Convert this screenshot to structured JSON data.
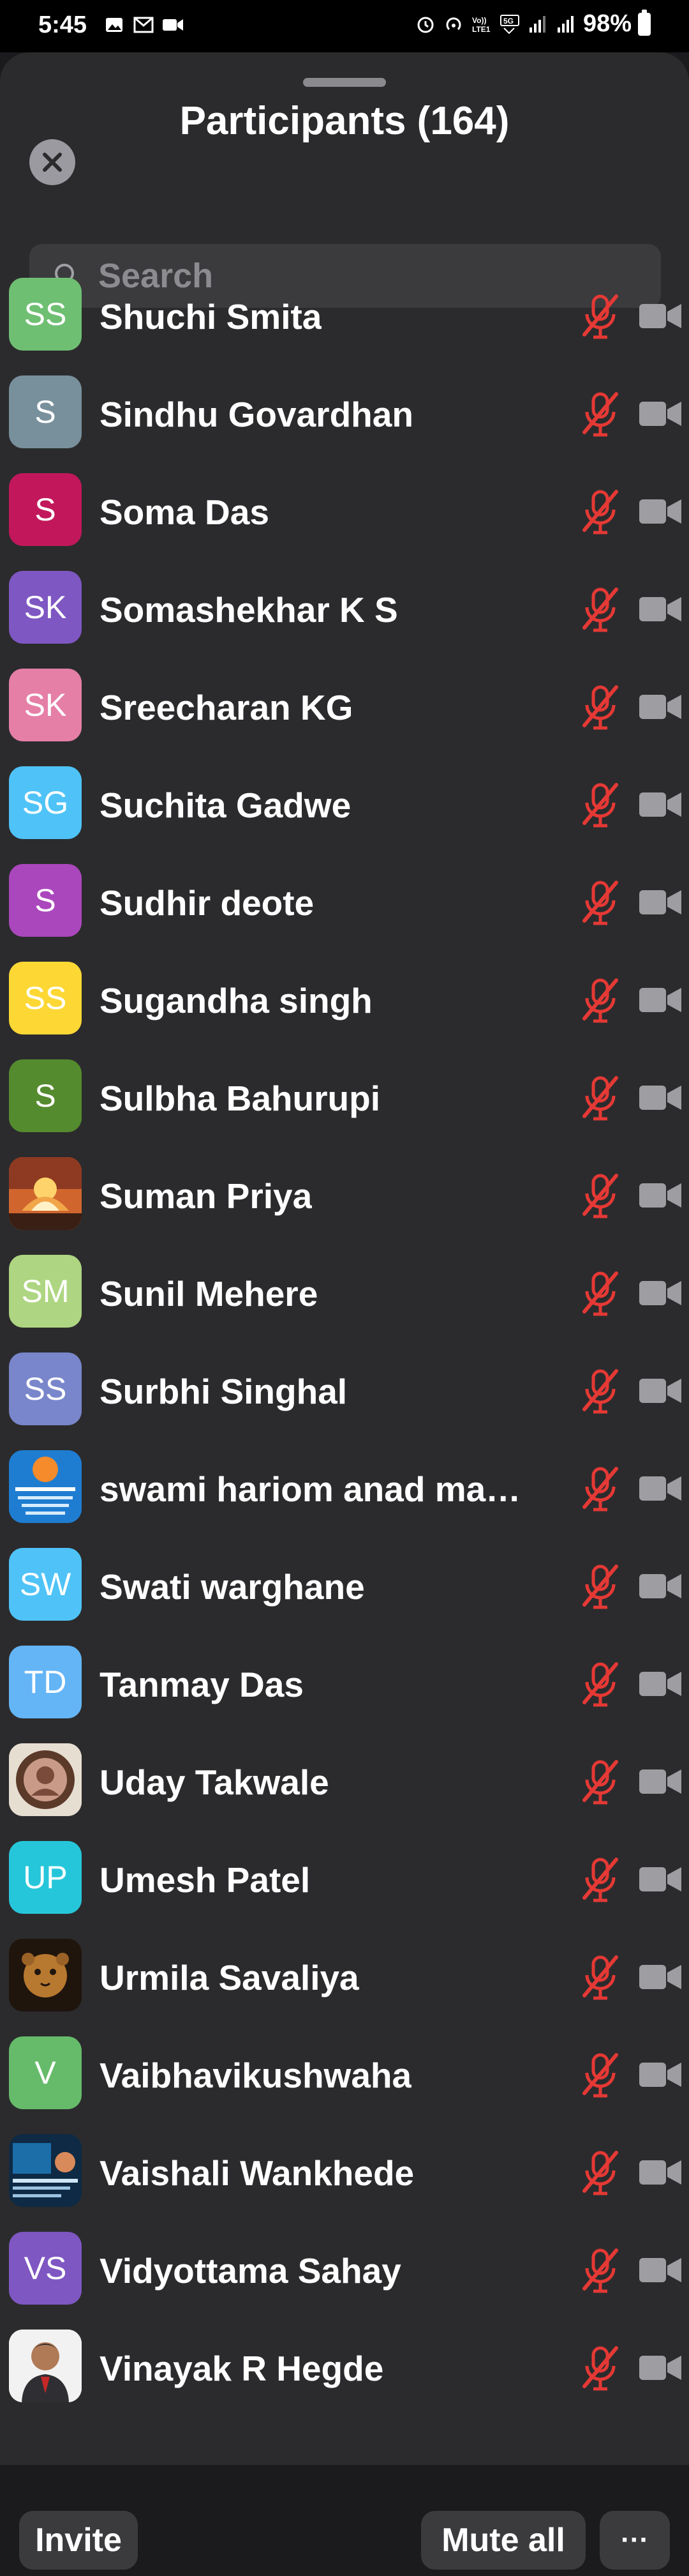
{
  "status": {
    "time": "5:45",
    "battery": "98%",
    "network": "5G"
  },
  "header": {
    "title": "Participants (164)"
  },
  "search": {
    "placeholder": "Search"
  },
  "participants": [
    {
      "name": "Shuchi Smita",
      "initials": "SS",
      "color": "#6fbf73"
    },
    {
      "name": "Sindhu Govardhan",
      "initials": "S",
      "color": "#78909c"
    },
    {
      "name": "Soma Das",
      "initials": "S",
      "color": "#c2185b"
    },
    {
      "name": "Somashekhar K S",
      "initials": "SK",
      "color": "#7e57c2"
    },
    {
      "name": "Sreecharan KG",
      "initials": "SK",
      "color": "#e57fa6"
    },
    {
      "name": "Suchita Gadwe",
      "initials": "SG",
      "color": "#4fc3f7"
    },
    {
      "name": "Sudhir deote",
      "initials": "S",
      "color": "#ab47bc"
    },
    {
      "name": "Sugandha singh",
      "initials": "SS",
      "color": "#fdd835"
    },
    {
      "name": "Sulbha Bahurupi",
      "initials": "S",
      "color": "#558b2f"
    },
    {
      "name": "Suman Priya",
      "initials": "",
      "color": "#c0582a",
      "photo": "sunset-lotus"
    },
    {
      "name": "Sunil Mehere",
      "initials": "SM",
      "color": "#aed581"
    },
    {
      "name": "Surbhi Singhal",
      "initials": "SS",
      "color": "#7986cb"
    },
    {
      "name": "swami hariom anad mah…",
      "initials": "",
      "color": "#1e6fb8",
      "photo": "blue-poster"
    },
    {
      "name": "Swati warghane",
      "initials": "SW",
      "color": "#4fc3f7"
    },
    {
      "name": "Tanmay Das",
      "initials": "TD",
      "color": "#64b5f6"
    },
    {
      "name": "Uday Takwale",
      "initials": "",
      "color": "#d8cfc4",
      "photo": "round-seal"
    },
    {
      "name": "Umesh Patel",
      "initials": "UP",
      "color": "#26c6da"
    },
    {
      "name": "Urmila Savaliya",
      "initials": "",
      "color": "#3a2414",
      "photo": "lion-cub"
    },
    {
      "name": "Vaibhavikushwaha",
      "initials": "V",
      "color": "#66bb6a"
    },
    {
      "name": "Vaishali Wankhede",
      "initials": "",
      "color": "#14344f",
      "photo": "poster"
    },
    {
      "name": "Vidyottama Sahay",
      "initials": "VS",
      "color": "#7e57c2"
    },
    {
      "name": "Vinayak R Hegde",
      "initials": "",
      "color": "#e8e8e8",
      "photo": "portrait"
    }
  ],
  "footer": {
    "invite": "Invite",
    "mute_all": "Mute all",
    "more": "···"
  },
  "colors": {
    "muted_mic": "#e53935",
    "camera_off": "#9e9ea2",
    "sheet_bg": "#2b2b2d"
  }
}
